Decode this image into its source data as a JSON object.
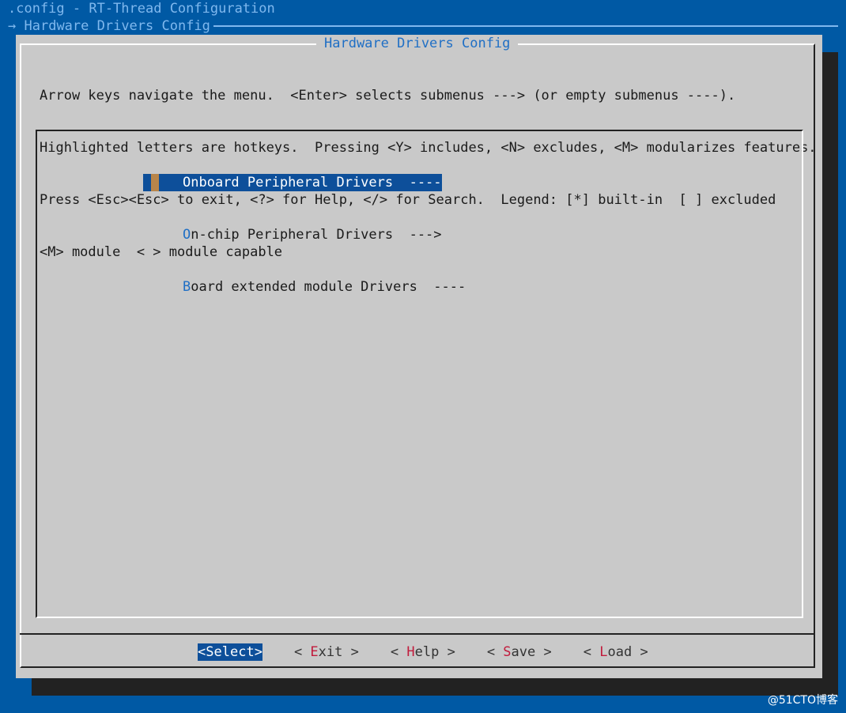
{
  "header": {
    "title": ".config - RT-Thread Configuration",
    "breadcrumb_arrow": "→",
    "breadcrumb": "Hardware Drivers Config"
  },
  "dialog": {
    "title": "Hardware Drivers Config",
    "help_lines": [
      "Arrow keys navigate the menu.  <Enter> selects submenus ---> (or empty submenus ----).",
      "Highlighted letters are hotkeys.  Pressing <Y> includes, <N> excludes, <M> modularizes features.",
      "Press <Esc><Esc> to exit, <?> for Help, </> for Search.  Legend: [*] built-in  [ ] excluded",
      "<M> module  < > module capable"
    ]
  },
  "menu": {
    "items": [
      {
        "hotkey": "O",
        "rest": "nboard Peripheral Drivers  ----",
        "selected": true
      },
      {
        "hotkey": "O",
        "rest": "n-chip Peripheral Drivers  --->",
        "selected": false
      },
      {
        "hotkey": "B",
        "rest": "oard extended module Drivers  ----",
        "selected": false
      }
    ]
  },
  "buttons": [
    {
      "prefix": "<",
      "hotkey": "S",
      "rest": "elect",
      "suffix": ">",
      "active": true
    },
    {
      "prefix": "< ",
      "hotkey": "E",
      "rest": "xit",
      "suffix": " >",
      "active": false
    },
    {
      "prefix": "< ",
      "hotkey": "H",
      "rest": "elp",
      "suffix": " >",
      "active": false
    },
    {
      "prefix": "< ",
      "hotkey": "S",
      "rest": "ave",
      "suffix": " >",
      "active": false
    },
    {
      "prefix": "< ",
      "hotkey": "L",
      "rest": "oad",
      "suffix": " >",
      "active": false
    }
  ],
  "watermark": "@51CTO博客",
  "colors": {
    "background": "#0059a4",
    "dialog": "#c9c9c9",
    "selection": "#0d4f9a",
    "hotkey_menu": "#1f6fc5",
    "hotkey_button": "#c11b3c"
  }
}
